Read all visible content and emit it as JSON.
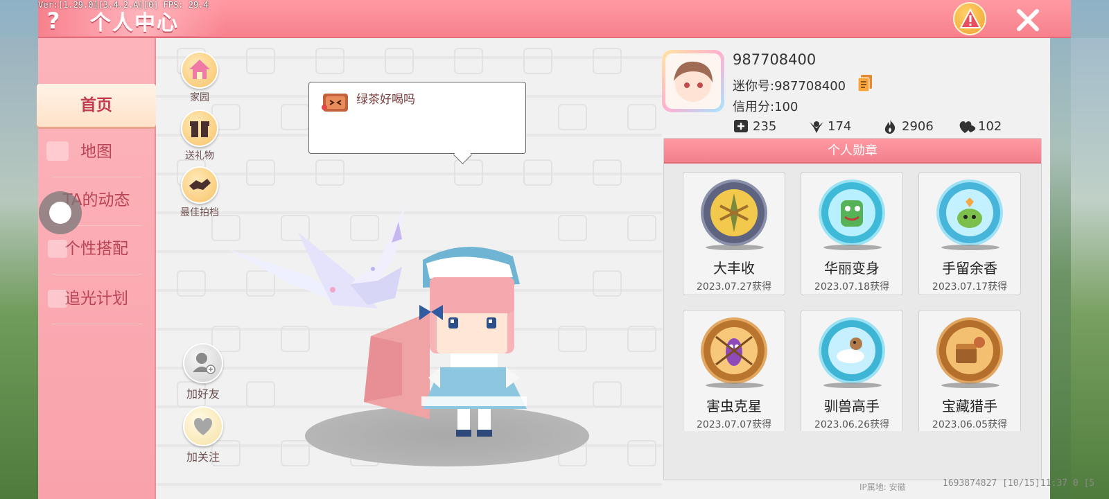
{
  "debug": "Ver:[1.29.0][3.4.2.A][0] FPS: 29.4",
  "header": {
    "title": "个人中心",
    "help_icon": "question-mark-icon",
    "report_icon": "warning-triangle-icon",
    "close_icon": "close-icon"
  },
  "sidebar": {
    "items": [
      {
        "label": "首页",
        "active": true
      },
      {
        "label": "地图"
      },
      {
        "label": "TA的动态"
      },
      {
        "label": "个性搭配"
      },
      {
        "label": "追光计划"
      }
    ]
  },
  "actions": {
    "home": "家园",
    "gift": "送礼物",
    "partner": "最佳拍档",
    "add_friend": "加好友",
    "follow": "加关注"
  },
  "speech": {
    "message": "绿茶好喝吗"
  },
  "profile": {
    "uid": "987708400",
    "mini_id": "迷你号:987708400",
    "credit": "信用分:100",
    "stats": {
      "friends": "235",
      "fans": "174",
      "popularity": "2906",
      "likes": "102"
    }
  },
  "medals": {
    "title": "个人勋章",
    "items": [
      {
        "name": "大丰收",
        "date": "2023.07.27获得",
        "icon": "harvest-medal-icon",
        "ring": "#5e6480",
        "core": "#f2c94c"
      },
      {
        "name": "华丽变身",
        "date": "2023.07.18获得",
        "icon": "transform-medal-icon",
        "ring": "#3fb9d8",
        "core": "#b8f0ff"
      },
      {
        "name": "手留余香",
        "date": "2023.07.17获得",
        "icon": "flower-medal-icon",
        "ring": "#47b4da",
        "core": "#c4f1ff"
      },
      {
        "name": "害虫克星",
        "date": "2023.07.07获得",
        "icon": "bug-medal-icon",
        "ring": "#b9742e",
        "core": "#f7c77a"
      },
      {
        "name": "驯兽高手",
        "date": "2023.06.26获得",
        "icon": "tamer-medal-icon",
        "ring": "#3fb5d6",
        "core": "#c6f0ff"
      },
      {
        "name": "宝藏猎手",
        "date": "2023.06.05获得",
        "icon": "treasure-medal-icon",
        "ring": "#b56f2c",
        "core": "#f3bf70"
      }
    ]
  },
  "footer": {
    "ip": "IP属地: 安徽",
    "timestamp": "1693874827   [10/15]11:37 0  [5"
  },
  "colors": {
    "accent": "#f7818d",
    "sidebar": "#f9a2ab",
    "nav_text": "#b84456"
  }
}
